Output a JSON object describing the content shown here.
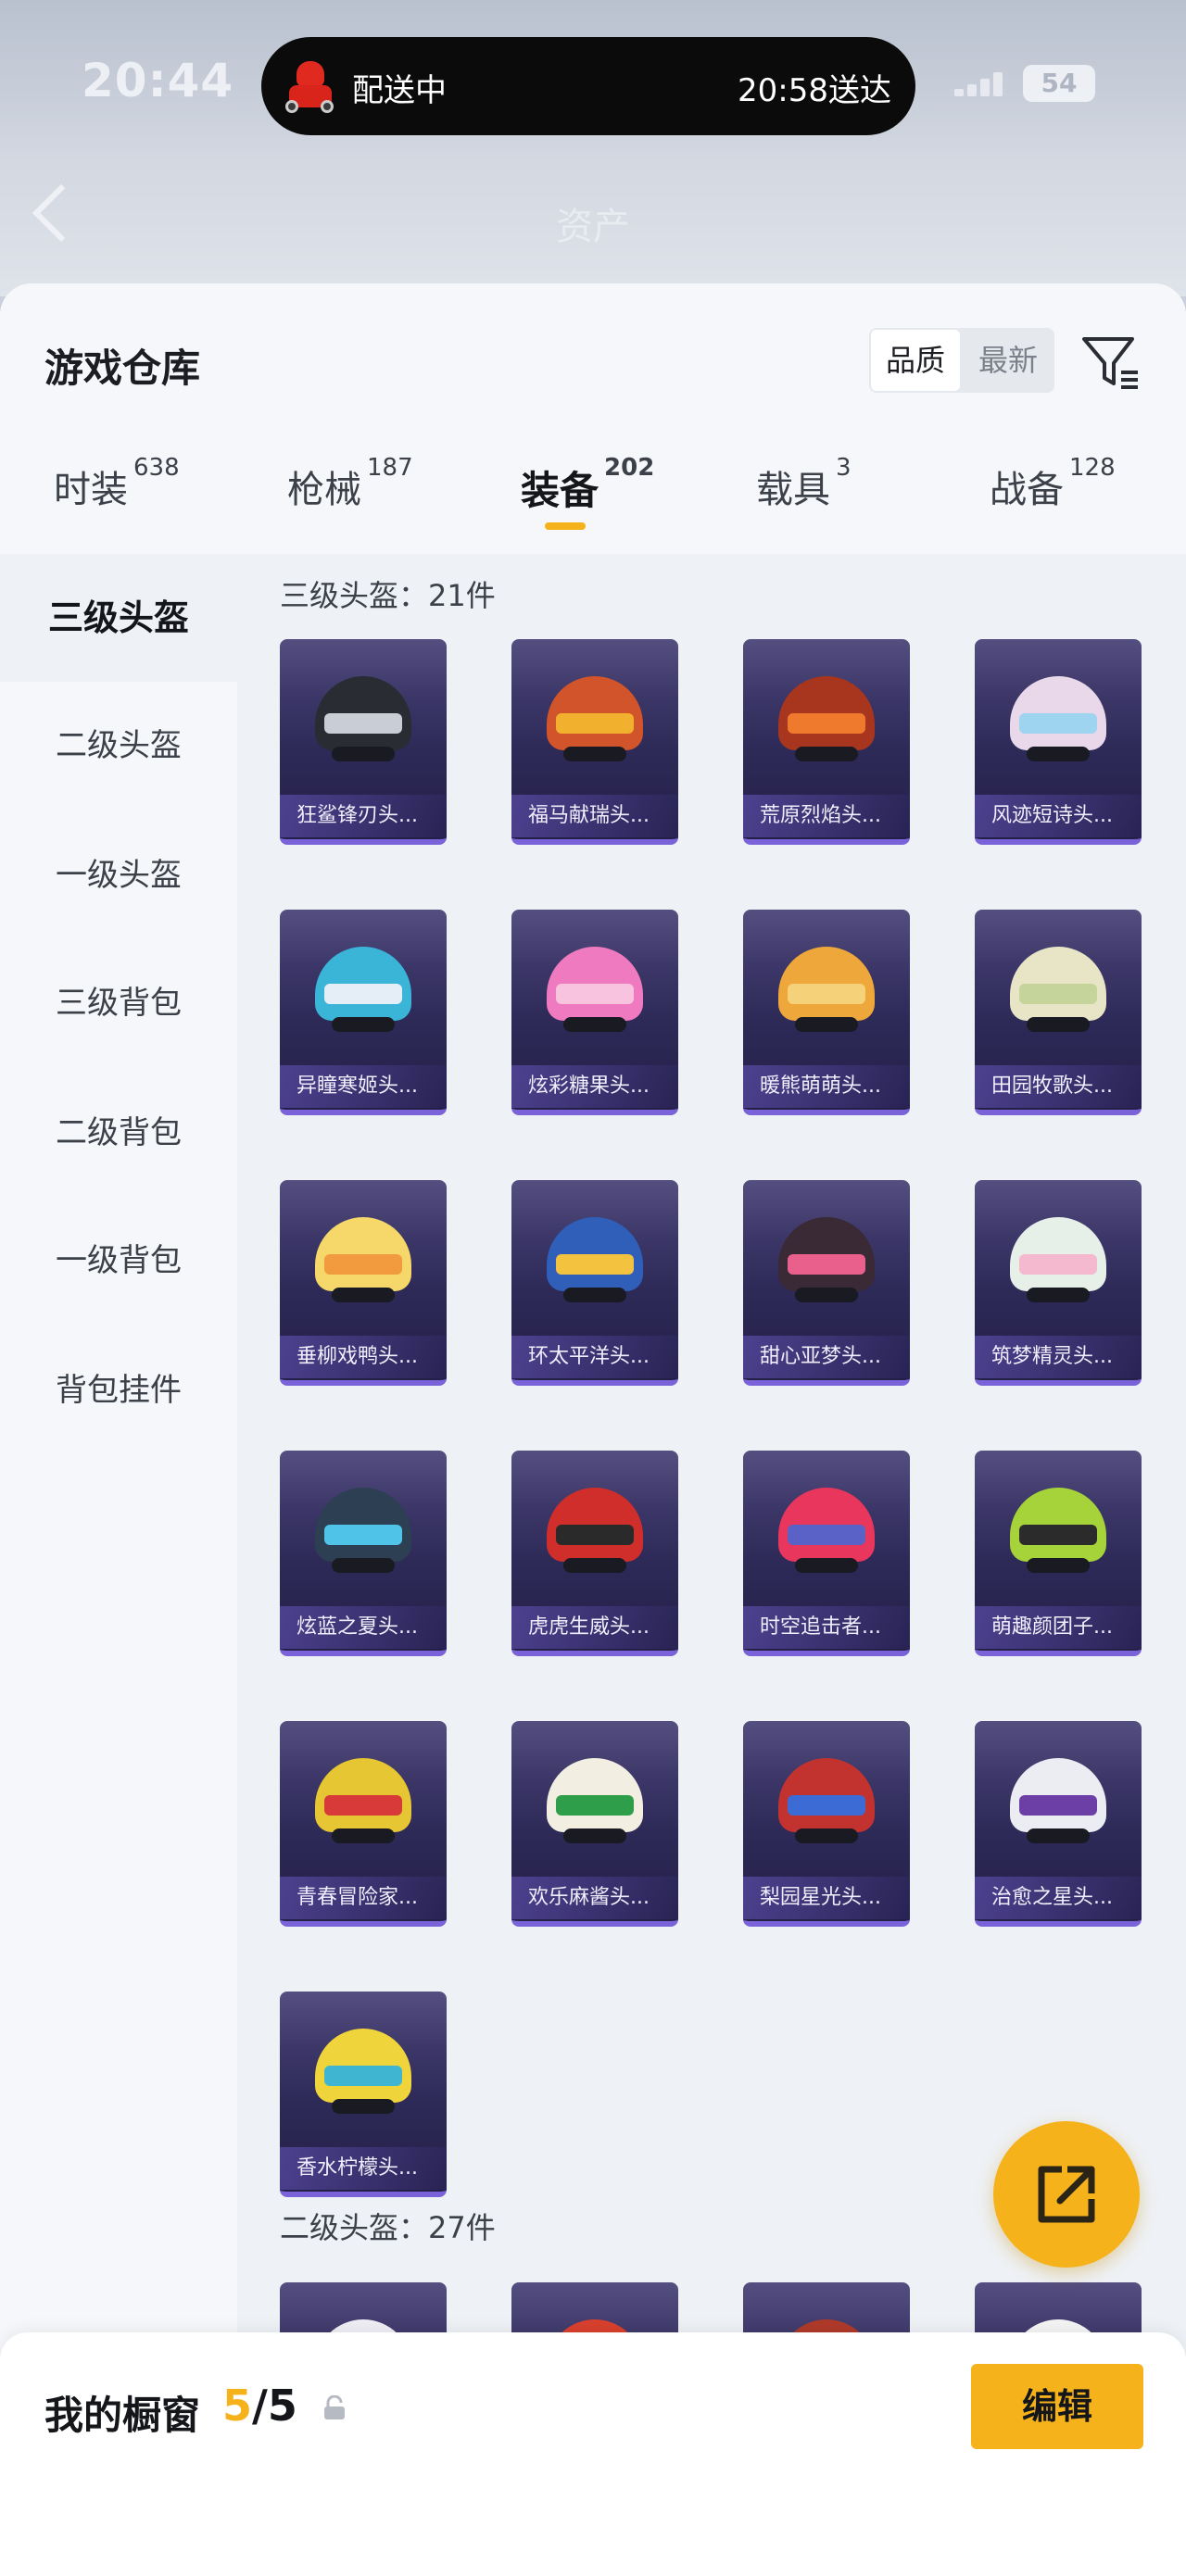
{
  "status_bar": {
    "time": "20:44",
    "battery": "54"
  },
  "delivery": {
    "status": "配送中",
    "eta": "20:58送达"
  },
  "nav": {
    "title": "资产"
  },
  "header": {
    "title": "游戏仓库",
    "sort": [
      "品质",
      "最新"
    ],
    "active_sort": "品质"
  },
  "tabs": [
    {
      "label": "时装",
      "count": "638"
    },
    {
      "label": "枪械",
      "count": "187"
    },
    {
      "label": "装备",
      "count": "202",
      "active": true
    },
    {
      "label": "载具",
      "count": "3"
    },
    {
      "label": "战备",
      "count": "128"
    }
  ],
  "categories": [
    "三级头盔",
    "二级头盔",
    "一级头盔",
    "三级背包",
    "二级背包",
    "一级背包",
    "背包挂件"
  ],
  "groups": [
    {
      "title": "三级头盔：21件",
      "items": [
        {
          "name": "狂鲨锋刃头...",
          "dome": "#2a2c34",
          "visor": "#c9cdd6"
        },
        {
          "name": "福马献瑞头...",
          "dome": "#d2542a",
          "visor": "#f1b12e"
        },
        {
          "name": "荒原烈焰头...",
          "dome": "#a8361f",
          "visor": "#ef7a2d"
        },
        {
          "name": "风迹短诗头...",
          "dome": "#e9d8ea",
          "visor": "#9fd4f0"
        },
        {
          "name": "异瞳寒姬头...",
          "dome": "#3ab5d8",
          "visor": "#e5eef6"
        },
        {
          "name": "炫彩糖果头...",
          "dome": "#f07ac0",
          "visor": "#f8c3df"
        },
        {
          "name": "暖熊萌萌头...",
          "dome": "#eda73b",
          "visor": "#f5d27a"
        },
        {
          "name": "田园牧歌头...",
          "dome": "#e8e4c6",
          "visor": "#c5d49a"
        },
        {
          "name": "垂柳戏鸭头...",
          "dome": "#f6d86a",
          "visor": "#f19a3e"
        },
        {
          "name": "环太平洋头...",
          "dome": "#2f5fb8",
          "visor": "#f3c340"
        },
        {
          "name": "甜心亚梦头...",
          "dome": "#3a2a35",
          "visor": "#e9608d"
        },
        {
          "name": "筑梦精灵头...",
          "dome": "#e7f0e8",
          "visor": "#f4b9cf"
        },
        {
          "name": "炫蓝之夏头...",
          "dome": "#2d3f52",
          "visor": "#4fc3e8"
        },
        {
          "name": "虎虎生威头...",
          "dome": "#cf2e2b",
          "visor": "#2a2a2a"
        },
        {
          "name": "时空追击者...",
          "dome": "#e8365d",
          "visor": "#5a62c8"
        },
        {
          "name": "萌趣颜团子...",
          "dome": "#a6d23a",
          "visor": "#2b2b2b"
        },
        {
          "name": "青春冒险家...",
          "dome": "#e6c632",
          "visor": "#d83a3a"
        },
        {
          "name": "欢乐麻酱头...",
          "dome": "#f2efe2",
          "visor": "#2f9e4b"
        },
        {
          "name": "梨园星光头...",
          "dome": "#c2332f",
          "visor": "#3d6bd6"
        },
        {
          "name": "治愈之星头...",
          "dome": "#ecedf2",
          "visor": "#6b3fa5"
        },
        {
          "name": "香水柠檬头...",
          "dome": "#efd43c",
          "visor": "#3fb5d2"
        }
      ]
    },
    {
      "title": "二级头盔：27件",
      "items": [
        {
          "name": "",
          "dome": "#f0eef5",
          "visor": "#8a78c8"
        },
        {
          "name": "",
          "dome": "#d9402d",
          "visor": "#f09a2f"
        },
        {
          "name": "",
          "dome": "#b03a2a",
          "visor": "#3a3a3a"
        },
        {
          "name": "",
          "dome": "#f4f4f4",
          "visor": "#e7e7e7"
        }
      ]
    }
  ],
  "showcase": {
    "label": "我的橱窗",
    "current": "5",
    "total": "/5"
  },
  "buttons": {
    "edit": "编辑"
  },
  "colors": {
    "accent": "#f6b21a",
    "card_top": "#4a4478",
    "card_bottom": "#241f47"
  }
}
